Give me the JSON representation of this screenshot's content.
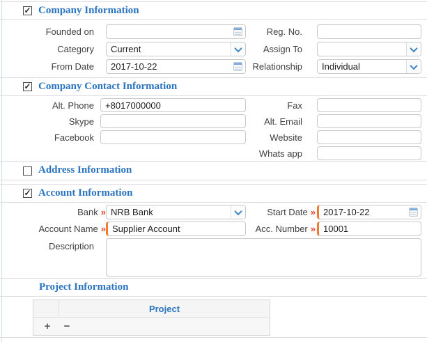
{
  "colors": {
    "title_blue": "#2b74c0",
    "required_marker": "#e8472b",
    "required_input_border": "#f07b31",
    "separator_line": "#dcdde4"
  },
  "icons": {
    "calendar": "calendar-icon",
    "chevron_down": "chevron-down-icon",
    "plus": "+",
    "minus": "−",
    "checkmark": "✓"
  },
  "company": {
    "title": "Company Information",
    "checked": true,
    "founded_on": {
      "label": "Founded on",
      "value": ""
    },
    "reg_no": {
      "label": "Reg. No.",
      "value": ""
    },
    "category": {
      "label": "Category",
      "value": "Current"
    },
    "assign_to": {
      "label": "Assign To",
      "value": ""
    },
    "from_date": {
      "label": "From Date",
      "value": "2017-10-22"
    },
    "relationship": {
      "label": "Relationship",
      "value": "Individual"
    }
  },
  "contact": {
    "title": "Company Contact Information",
    "checked": true,
    "alt_phone": {
      "label": "Alt. Phone",
      "value": "+8017000000"
    },
    "fax": {
      "label": "Fax",
      "value": ""
    },
    "skype": {
      "label": "Skype",
      "value": ""
    },
    "alt_email": {
      "label": "Alt. Email",
      "value": ""
    },
    "facebook": {
      "label": "Facebook",
      "value": ""
    },
    "website": {
      "label": "Website",
      "value": ""
    },
    "whatsapp": {
      "label": "Whats app",
      "value": ""
    }
  },
  "address": {
    "title": "Address Information",
    "checked": false
  },
  "account": {
    "title": "Account Information",
    "checked": true,
    "required_marker": "»",
    "bank": {
      "label": "Bank",
      "value": "NRB Bank"
    },
    "start_date": {
      "label": "Start Date",
      "value": "2017-10-22"
    },
    "account_name": {
      "label": "Account Name",
      "value": "Supplier Account"
    },
    "acc_number": {
      "label": "Acc. Number",
      "value": "10001"
    },
    "description": {
      "label": "Description",
      "value": ""
    }
  },
  "project": {
    "title": "Project Information",
    "table": {
      "column_header": "Project",
      "add_label": "+",
      "remove_label": "−"
    }
  }
}
